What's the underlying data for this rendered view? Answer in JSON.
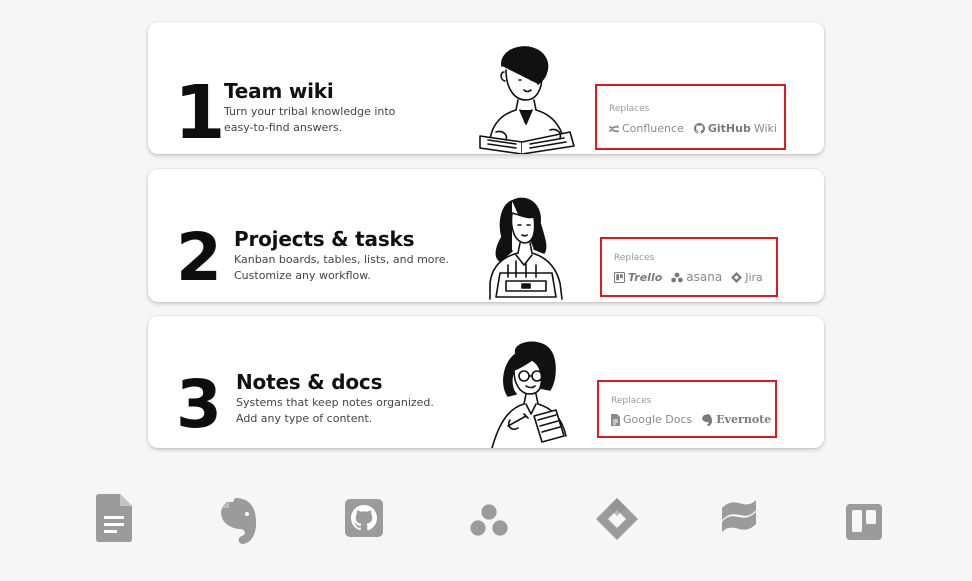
{
  "cards": [
    {
      "number": "1",
      "title": "Team wiki",
      "desc_line1": "Turn your tribal knowledge into",
      "desc_line2": "easy-to-find answers.",
      "replaces_label": "Replaces",
      "logos": [
        {
          "name": "Confluence",
          "icon": "confluence-icon"
        },
        {
          "name": "GitHub",
          "suffix": "Wiki",
          "icon": "github-icon"
        }
      ]
    },
    {
      "number": "2",
      "title": "Projects & tasks",
      "desc_line1": "Kanban boards, tables, lists, and more.",
      "desc_line2": "Customize any workflow.",
      "replaces_label": "Replaces",
      "logos": [
        {
          "name": "Trello",
          "icon": "trello-icon"
        },
        {
          "name": "asana",
          "icon": "asana-icon"
        },
        {
          "name": "Jira",
          "icon": "jira-icon"
        }
      ]
    },
    {
      "number": "3",
      "title": "Notes & docs",
      "desc_line1": "Systems that keep notes organized.",
      "desc_line2": "Add any type of content.",
      "replaces_label": "Replaces",
      "logos": [
        {
          "name": "Google Docs",
          "icon": "google-docs-icon"
        },
        {
          "name": "Evernote",
          "icon": "evernote-icon"
        }
      ]
    }
  ],
  "bottom_icons": [
    "google-docs-icon",
    "evernote-icon",
    "github-icon",
    "asana-icon",
    "jira-icon",
    "confluence-icon",
    "trello-icon"
  ],
  "colors": {
    "highlight_box": "#e0191d",
    "icon_gray": "#9b9b9b",
    "background": "#f7f6f6"
  }
}
